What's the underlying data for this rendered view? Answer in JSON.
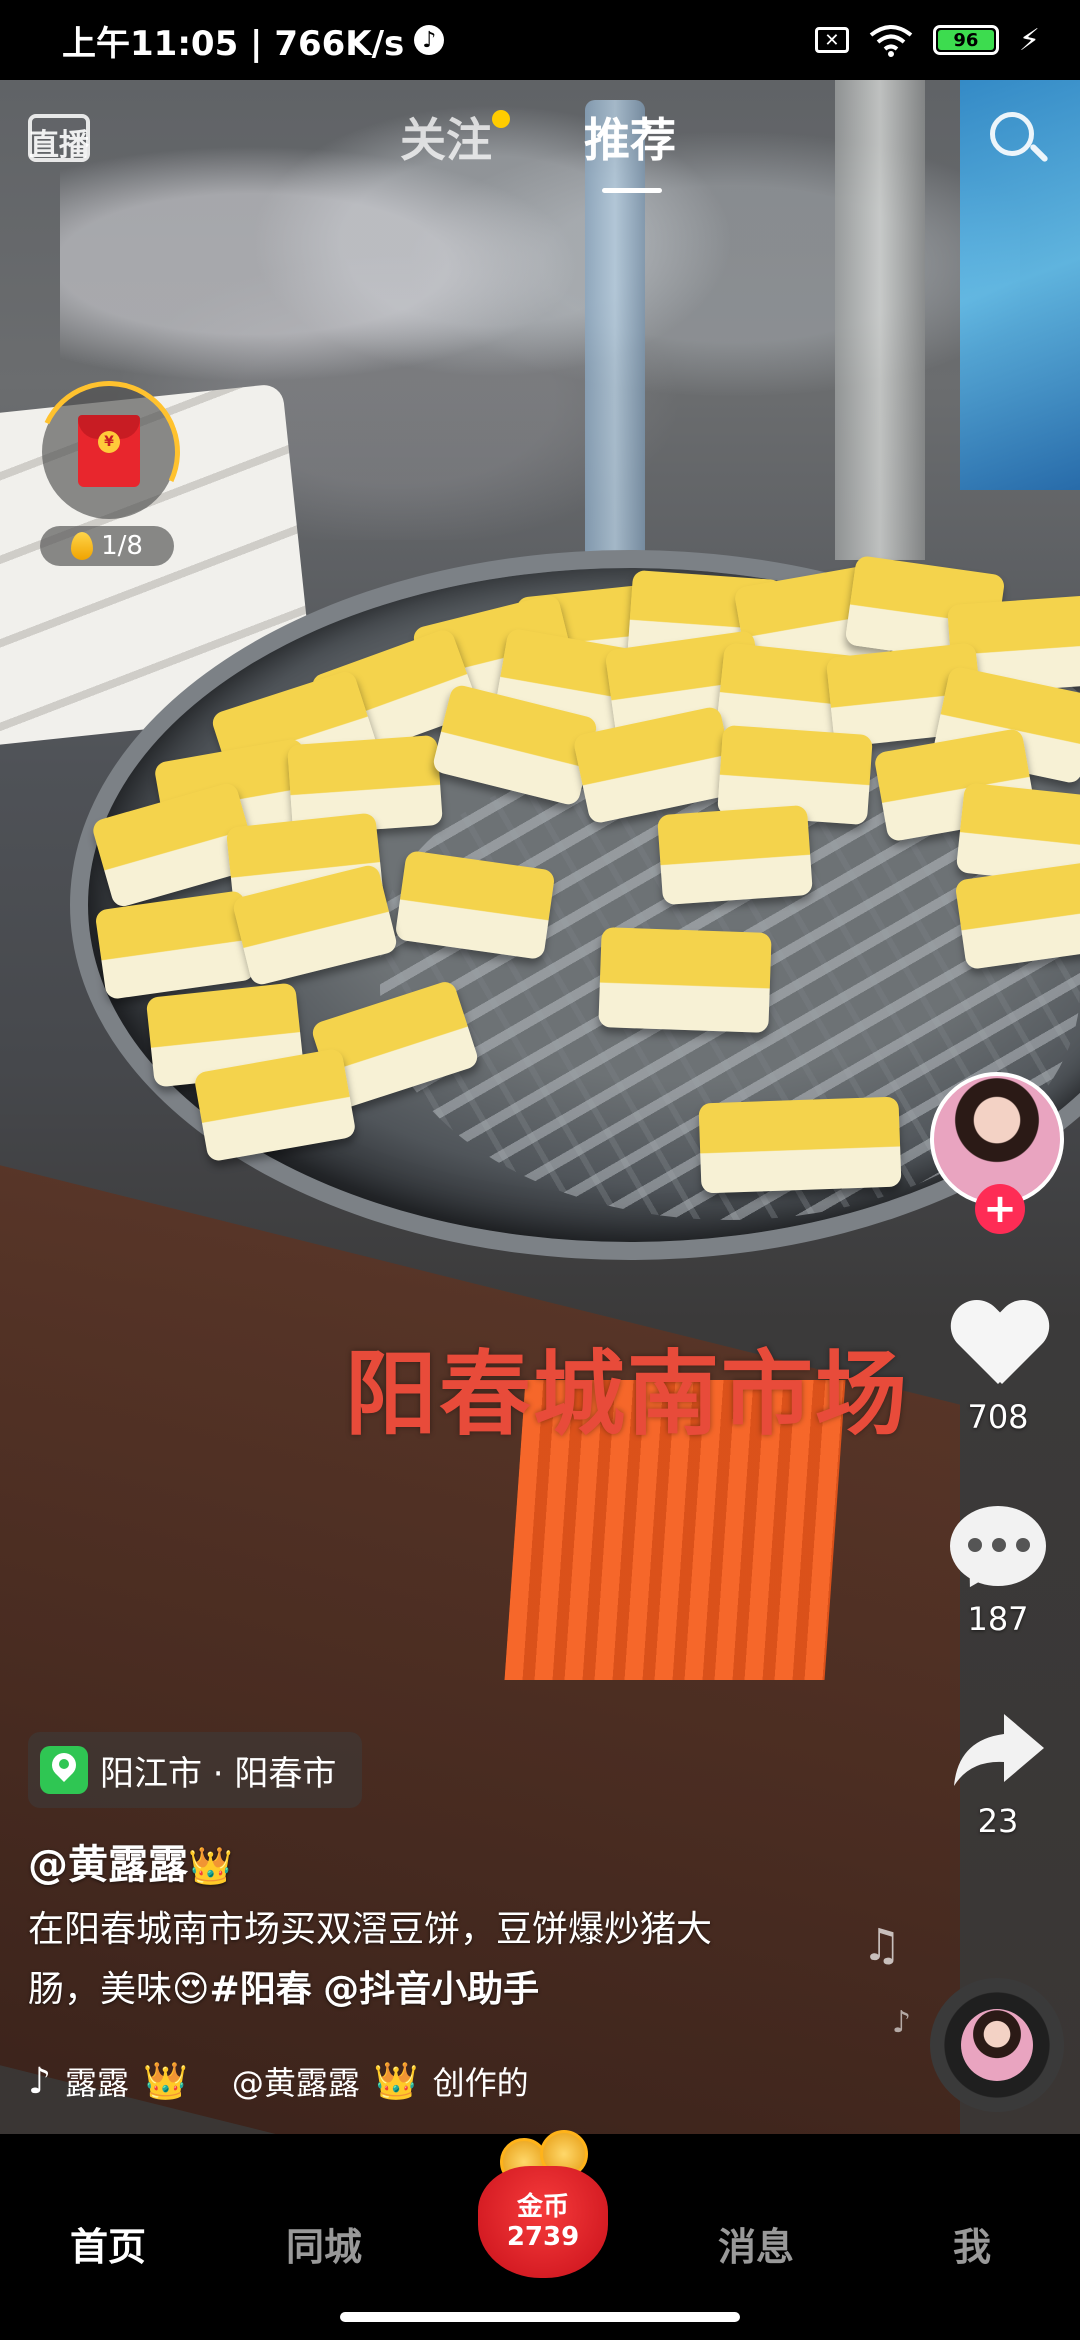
{
  "status_bar": {
    "time_speed": "上午11:05 | 766K/s",
    "battery": "96"
  },
  "top_tabs": {
    "live_label": "直播",
    "follow": "关注",
    "recommend": "推荐"
  },
  "red_packet": {
    "progress_text": "1/8"
  },
  "video": {
    "caption": "阳春城南市场"
  },
  "actions": {
    "likes": "708",
    "comments": "187",
    "shares": "23",
    "follow_symbol": "+"
  },
  "post": {
    "location": "阳江市 · 阳春市",
    "author": "@黄露露",
    "description_line1": "在阳春城南市场买双滘豆饼，豆饼爆炒猪大",
    "description_line2_prefix": "肠，美味😍",
    "hashtag": "#阳春",
    "mention": "@抖音小助手",
    "music_text_a": "露露",
    "music_text_b": "@黄露露",
    "music_suffix": "创作的"
  },
  "bottom_nav": {
    "home": "首页",
    "nearby": "同城",
    "coin_label": "金币",
    "coin_count": "2739",
    "messages": "消息",
    "me": "我"
  },
  "colors": {
    "accent_red": "#fe2c55",
    "caption_red": "#e84b3a",
    "battery_green": "#3ddc4f",
    "location_green": "#2fc653"
  }
}
